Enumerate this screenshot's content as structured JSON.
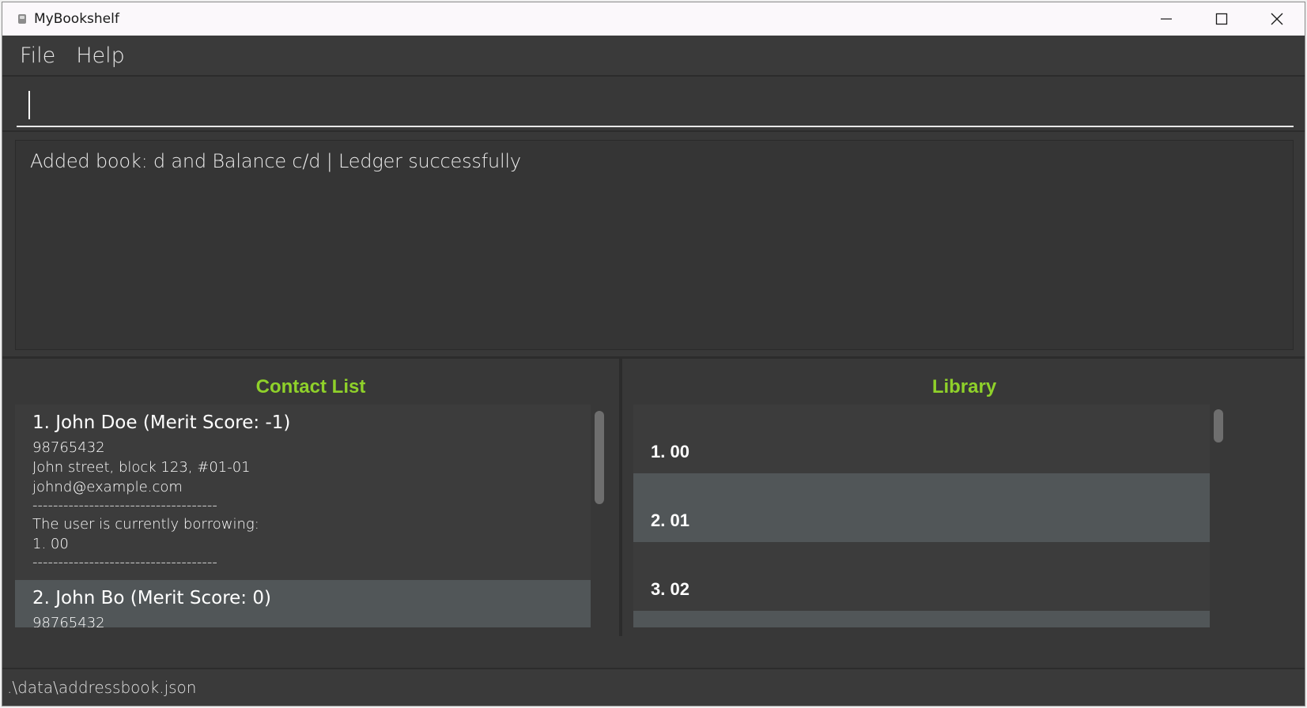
{
  "window": {
    "title": "MyBookshelf"
  },
  "menu": {
    "items": [
      "File",
      "Help"
    ]
  },
  "command": {
    "value": "",
    "placeholder": ""
  },
  "result": {
    "message": "Added book: d and Balance c/d | Ledger successfully"
  },
  "contact_panel": {
    "title": "Contact List",
    "contacts": [
      {
        "header": "1.  John Doe (Merit Score: -1)",
        "phone": "98765432",
        "address": "John street, block 123, #01-01",
        "email": "johnd@example.com",
        "divider": "------------------------------------",
        "borrowing_label": "The user is currently borrowing:",
        "borrowing_item": "1. 00",
        "divider_end": "------------------------------------"
      },
      {
        "header": "2.  John Bo (Merit Score: 0)",
        "phone": "98765432"
      }
    ]
  },
  "library_panel": {
    "title": "Library",
    "books": [
      "1. 00",
      "2. 01",
      "3. 02"
    ]
  },
  "status": {
    "file_path": ".\\data\\addressbook.json"
  }
}
